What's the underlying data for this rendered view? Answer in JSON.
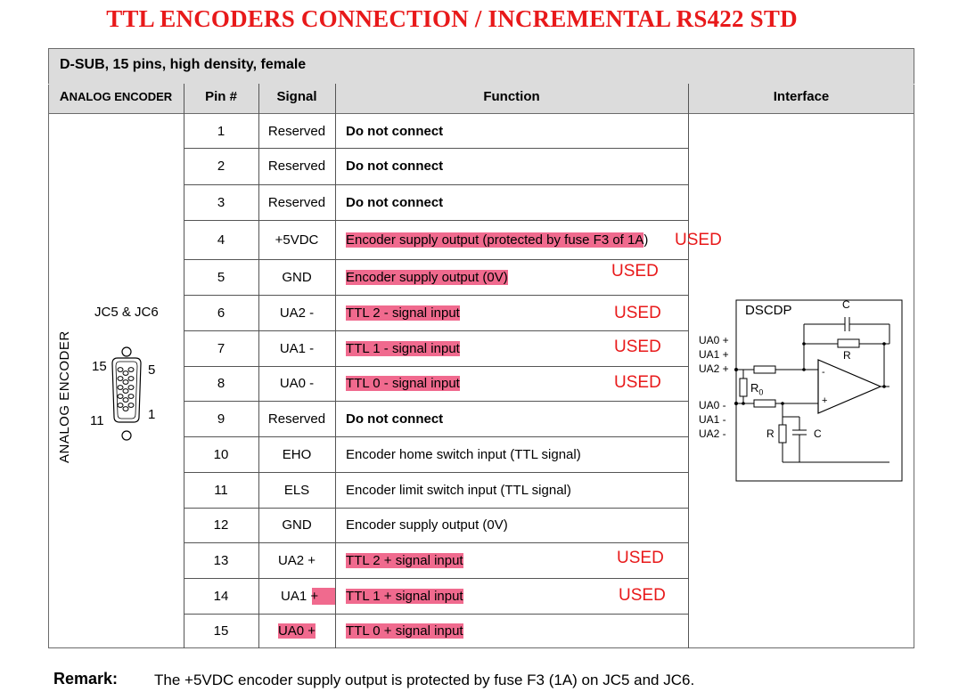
{
  "title": "TTL ENCODERS CONNECTION / INCREMENTAL RS422 STD",
  "connector": "D-SUB, 15 pins, high density, female",
  "headers": {
    "analog_first": "A",
    "analog_rest": "NALOG ENCODER",
    "pin": "Pin #",
    "signal": "Signal",
    "function": "Function",
    "interface": "Interface"
  },
  "connector_label": "JC5 & JC6",
  "vertical_label": "ANALOG ENCODER",
  "pin_labels": {
    "p15": "15",
    "p5": "5",
    "p11": "11",
    "p1": "1"
  },
  "rows": [
    {
      "pin": "1",
      "signal": "Reserved",
      "function": "Do not connect",
      "bold": true,
      "hl_signal": false,
      "hl_function": false,
      "used": ""
    },
    {
      "pin": "2",
      "signal": "Reserved",
      "function": "Do not connect",
      "bold": true,
      "hl_signal": false,
      "hl_function": false,
      "used": ""
    },
    {
      "pin": "3",
      "signal": "Reserved",
      "function": "Do not connect",
      "bold": true,
      "hl_signal": false,
      "hl_function": false,
      "used": ""
    },
    {
      "pin": "4",
      "signal": "+5VDC",
      "function": "Encoder supply output (protected by fuse F3 of 1A",
      "function_tail": ")",
      "bold": false,
      "hl_signal": false,
      "hl_function": true,
      "used": "USED"
    },
    {
      "pin": "5",
      "signal": "GND",
      "function": "Encoder supply output (0V)",
      "bold": false,
      "hl_signal": false,
      "hl_function": true,
      "used": "USED"
    },
    {
      "pin": "6",
      "signal": "UA2 -",
      "function": "TTL 2 - signal input",
      "bold": false,
      "hl_signal": false,
      "hl_function": true,
      "used": "USED"
    },
    {
      "pin": "7",
      "signal": "UA1 -",
      "function": "TTL 1 - signal input",
      "bold": false,
      "hl_signal": false,
      "hl_function": true,
      "used": "USED"
    },
    {
      "pin": "8",
      "signal": "UA0 -",
      "function": "TTL 0 - signal input",
      "bold": false,
      "hl_signal": false,
      "hl_function": true,
      "used": "USED"
    },
    {
      "pin": "9",
      "signal": "Reserved",
      "function": "Do not connect",
      "bold": true,
      "hl_signal": false,
      "hl_function": false,
      "used": ""
    },
    {
      "pin": "10",
      "signal": "EHO",
      "function": "Encoder home switch input (TTL signal)",
      "bold": false,
      "hl_signal": false,
      "hl_function": false,
      "used": ""
    },
    {
      "pin": "11",
      "signal": "ELS",
      "function": "Encoder limit switch input (TTL signal)",
      "bold": false,
      "hl_signal": false,
      "hl_function": false,
      "used": ""
    },
    {
      "pin": "12",
      "signal": "GND",
      "function": "Encoder supply output (0V)",
      "bold": false,
      "hl_signal": false,
      "hl_function": false,
      "used": ""
    },
    {
      "pin": "13",
      "signal": "UA2 +",
      "function": "TTL 2 + signal input",
      "bold": false,
      "hl_signal": false,
      "hl_function": true,
      "used": "USED"
    },
    {
      "pin": "14",
      "signal": "UA1 +",
      "function": "TTL 1 + signal input",
      "bold": false,
      "hl_signal": "partial",
      "hl_function": true,
      "used": "USED"
    },
    {
      "pin": "15",
      "signal": "UA0 +",
      "function": "TTL 0 + signal input",
      "bold": false,
      "hl_signal": true,
      "hl_function": true,
      "used": ""
    }
  ],
  "schematic": {
    "name": "DSCDP",
    "inputs_plus": [
      "UA0 +",
      "UA1 +",
      "UA2 +"
    ],
    "inputs_minus": [
      "UA0 -",
      "UA1 -",
      "UA2 -"
    ],
    "cap_top": "C",
    "res_top": "R",
    "r0": "R",
    "r0_sub": "0",
    "res_bottom": "R",
    "cap_bottom": "C",
    "minus_sign": "-",
    "plus_sign": "+"
  },
  "remark": {
    "label": "Remark:",
    "text": "The +5VDC encoder supply output is protected by fuse F3 (1A) on JC5 and JC6."
  }
}
